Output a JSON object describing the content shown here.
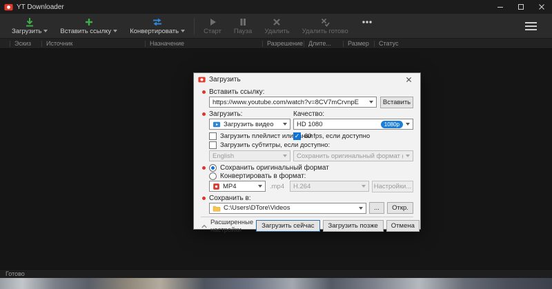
{
  "window": {
    "title": "YT Downloader",
    "status": "Готово"
  },
  "toolbar": {
    "download": "Загрузить",
    "paste_link": "Вставить ссылку",
    "convert": "Конвертировать",
    "start": "Старт",
    "pause": "Пауза",
    "delete": "Удалить",
    "delete_done": "Удалить готово"
  },
  "columns": [
    "Эскиз",
    "Источник",
    "Назначение",
    "Разрешение",
    "Длите...",
    "Размер",
    "Статус"
  ],
  "dialog": {
    "title": "Загрузить",
    "paste_label": "Вставить ссылку:",
    "url_value": "https://www.youtube.com/watch?v=8CV7mCrvnpE",
    "paste_button": "Вставить",
    "download_label": "Загрузить:",
    "quality_label": "Качество:",
    "download_mode": "Загрузить видео",
    "quality_value": "HD 1080",
    "quality_badge": "1080p",
    "playlist_checkbox": "Загрузить плейлист или канал",
    "fps_checkbox": "60 fps, если доступно",
    "subtitles_checkbox": "Загрузить субтитры, если доступно:",
    "subtitle_lang": "English",
    "subtitle_format": "Сохранить оригинальный формат (.vtt)",
    "keep_format_radio": "Сохранить оригинальный формат",
    "convert_radio": "Конвертировать в формат:",
    "format_value": "MP4",
    "format_ext": ".mp4",
    "codec_value": "H.264",
    "settings_button": "Настройки...",
    "save_label": "Сохранить в:",
    "save_path": "C:\\Users\\DTore\\Videos",
    "browse_button": "...",
    "open_button": "Откр.",
    "advanced_label": "Расширенные настройки",
    "download_now_button": "Загрузить сейчас",
    "download_later_button": "Загрузить позже",
    "cancel_button": "Отмена"
  }
}
